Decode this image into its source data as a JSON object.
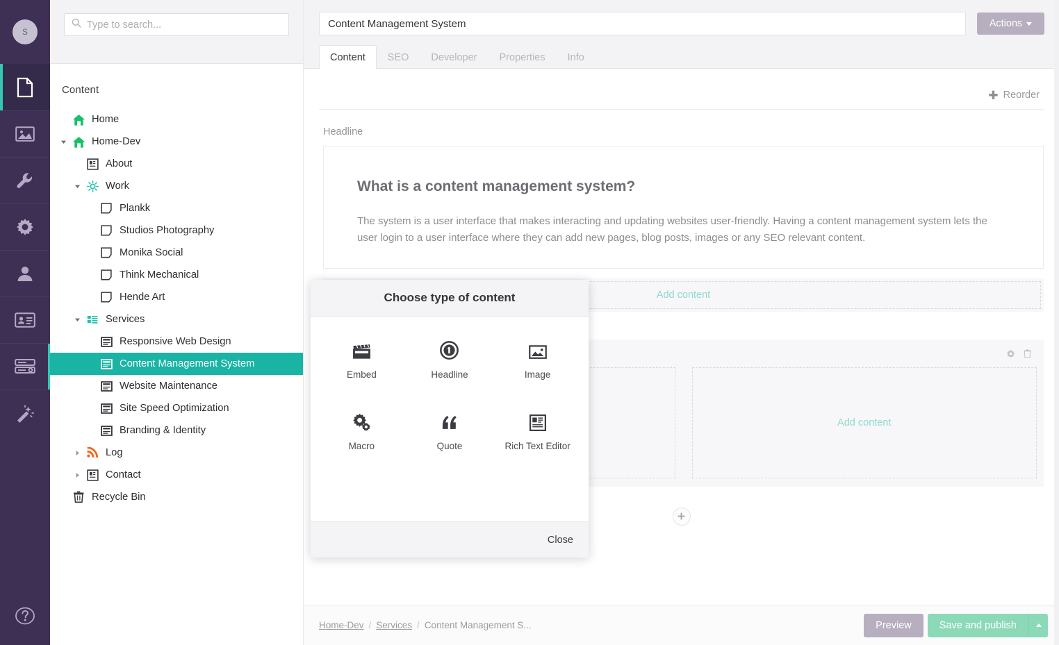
{
  "rail": {
    "avatar_initial": "S",
    "items": [
      {
        "name": "content",
        "icon": "document-icon",
        "active": true
      },
      {
        "name": "media",
        "icon": "image-icon",
        "active": false
      },
      {
        "name": "settings",
        "icon": "wrench-icon",
        "active": false
      },
      {
        "name": "developer",
        "icon": "gear-icon",
        "active": false
      },
      {
        "name": "users",
        "icon": "user-icon",
        "active": false
      },
      {
        "name": "members",
        "icon": "id-card-icon",
        "active": false
      },
      {
        "name": "forms",
        "icon": "server-icon",
        "active": false
      },
      {
        "name": "packages",
        "icon": "magic-wand-icon",
        "active": false
      }
    ],
    "help_icon": "help-circle-icon"
  },
  "search": {
    "placeholder": "Type to search...",
    "value": "",
    "icon": "search-icon"
  },
  "tree": {
    "title": "Content",
    "items": [
      {
        "label": "Home",
        "icon": "home-icon",
        "depth": 0,
        "caret": "",
        "selected": false
      },
      {
        "label": "Home-Dev",
        "icon": "home-icon",
        "depth": 0,
        "caret": "down",
        "selected": false
      },
      {
        "label": "About",
        "icon": "article-icon",
        "depth": 1,
        "caret": "",
        "selected": false
      },
      {
        "label": "Work",
        "icon": "sun-icon",
        "depth": 1,
        "caret": "down",
        "selected": false
      },
      {
        "label": "Plankk",
        "icon": "tag-icon",
        "depth": 2,
        "caret": "",
        "selected": false
      },
      {
        "label": "Studios Photography",
        "icon": "tag-icon",
        "depth": 2,
        "caret": "",
        "selected": false
      },
      {
        "label": "Monika Social",
        "icon": "tag-icon",
        "depth": 2,
        "caret": "",
        "selected": false
      },
      {
        "label": "Think Mechanical",
        "icon": "tag-icon",
        "depth": 2,
        "caret": "",
        "selected": false
      },
      {
        "label": "Hende Art",
        "icon": "tag-icon",
        "depth": 2,
        "caret": "",
        "selected": false
      },
      {
        "label": "Services",
        "icon": "list-icon",
        "depth": 1,
        "caret": "down",
        "selected": false
      },
      {
        "label": "Responsive Web Design",
        "icon": "page-icon",
        "depth": 2,
        "caret": "",
        "selected": false
      },
      {
        "label": "Content Management System",
        "icon": "page-icon",
        "depth": 2,
        "caret": "",
        "selected": true
      },
      {
        "label": "Website Maintenance",
        "icon": "page-icon",
        "depth": 2,
        "caret": "",
        "selected": false
      },
      {
        "label": "Site Speed Optimization",
        "icon": "page-icon",
        "depth": 2,
        "caret": "",
        "selected": false
      },
      {
        "label": "Branding & Identity",
        "icon": "page-icon",
        "depth": 2,
        "caret": "",
        "selected": false
      },
      {
        "label": "Log",
        "icon": "rss-icon",
        "depth": 1,
        "caret": "right",
        "selected": false
      },
      {
        "label": "Contact",
        "icon": "article-icon",
        "depth": 1,
        "caret": "right",
        "selected": false
      },
      {
        "label": "Recycle Bin",
        "icon": "trash-icon",
        "depth": 0,
        "caret": "",
        "selected": false
      }
    ]
  },
  "header": {
    "node_name": "Content Management System",
    "actions_label": "Actions",
    "tabs": [
      {
        "label": "Content",
        "active": true
      },
      {
        "label": "SEO",
        "active": false
      },
      {
        "label": "Developer",
        "active": false
      },
      {
        "label": "Properties",
        "active": false
      },
      {
        "label": "Info",
        "active": false
      }
    ]
  },
  "editor": {
    "reorder_label": "Reorder",
    "grid_label": "Headline",
    "headline_title": "What is a content management system?",
    "headline_body": "The system is a user interface that makes interacting and updating websites user-friendly. Having a content management system lets the user login to a user interface where they can add new pages, blog posts, images or any SEO relevant content.",
    "add_content_label": "Add content",
    "add_content_left": "Add content",
    "add_content_right": "Add content",
    "settings_icon": "gear-icon",
    "delete_icon": "trash-icon",
    "add_row_icon": "plus-icon"
  },
  "modal": {
    "title": "Choose type of content",
    "close_label": "Close",
    "options": [
      {
        "label": "Embed",
        "icon": "clapperboard-icon"
      },
      {
        "label": "Headline",
        "icon": "circle-one-icon"
      },
      {
        "label": "Image",
        "icon": "image-icon"
      },
      {
        "label": "Macro",
        "icon": "gears-icon"
      },
      {
        "label": "Quote",
        "icon": "quote-icon"
      },
      {
        "label": "Rich Text Editor",
        "icon": "rich-text-icon"
      }
    ]
  },
  "footer": {
    "breadcrumb": [
      {
        "label": "Home-Dev",
        "link": true
      },
      {
        "label": "Services",
        "link": true
      },
      {
        "label": "Content Management S...",
        "link": false
      }
    ],
    "separator": "/",
    "preview_label": "Preview",
    "publish_label": "Save and publish"
  },
  "colors": {
    "rail_bg": "#3d3054",
    "accent_teal": "#1ab4a5",
    "accent_green": "#8cd9b8",
    "muted_purple": "#b7afc0",
    "add_content_text": "#8fd9cd"
  }
}
